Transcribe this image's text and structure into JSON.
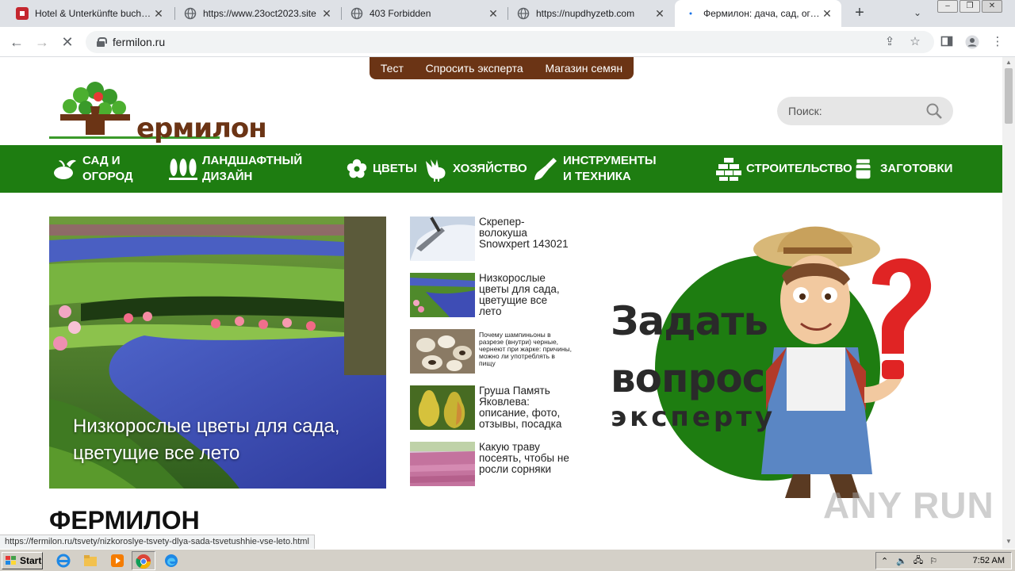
{
  "browser": {
    "tabs": [
      {
        "title": "Hotel & Unterkünfte buchen | A",
        "active": false,
        "favicon_color": "#c4262e"
      },
      {
        "title": "https://www.23oct2023.site",
        "active": false,
        "favicon_color": "#5f6368"
      },
      {
        "title": "403 Forbidden",
        "active": false,
        "favicon_color": "#5f6368"
      },
      {
        "title": "https://nupdhyzetb.com",
        "active": false,
        "favicon_color": "#5f6368"
      },
      {
        "title": "Фермилон: дача, сад, огород",
        "active": true,
        "favicon_color": "#1e7d11"
      }
    ],
    "new_tab": "+",
    "address": "fermilon.ru",
    "status_url": "https://fermilon.ru/tsvety/nizkoroslye-tsvety-dlya-sada-tsvetushhie-vse-leto.html"
  },
  "site": {
    "top_menu": [
      "Тест",
      "Спросить эксперта",
      "Магазин семян"
    ],
    "logo_text": "ермилон",
    "search_placeholder": "Поиск:",
    "main_nav": [
      {
        "label": "Сад и огород",
        "icon": "vegetable-icon"
      },
      {
        "label": "Ландшафтный дизайн",
        "icon": "trees-icon"
      },
      {
        "label": "Цветы",
        "icon": "flower-icon"
      },
      {
        "label": "Хозяйство",
        "icon": "rooster-icon"
      },
      {
        "label": "Инструменты и техника",
        "icon": "shovel-icon"
      },
      {
        "label": "Строительство",
        "icon": "bricks-icon"
      },
      {
        "label": "Заготовки",
        "icon": "jar-icon"
      }
    ],
    "hero_caption": "Низкорослые цветы для сада, цветущие все лето",
    "side_articles": [
      "Скрепер-волокуша Snowxpert 143021",
      "Низкорослые цветы для сада, цветущие все лето",
      "Почему шампиньоны в разрезе (внутри) черные, чернеют при жарке: причины, можно ли употреблять в пищу",
      "Груша Память Яковлева: описание, фото, отзывы, посадка",
      "Какую траву посеять, чтобы не росли сорняки"
    ],
    "promo": {
      "line1": "Задать",
      "line2": "вопрос",
      "line3": "эксперту"
    },
    "page_heading": "ФЕРМИЛОН"
  },
  "watermark": "ANY RUN",
  "taskbar": {
    "start_label": "Start",
    "clock": "7:52 AM"
  },
  "colors": {
    "green": "#1e7d11",
    "brown": "#6b3415"
  }
}
